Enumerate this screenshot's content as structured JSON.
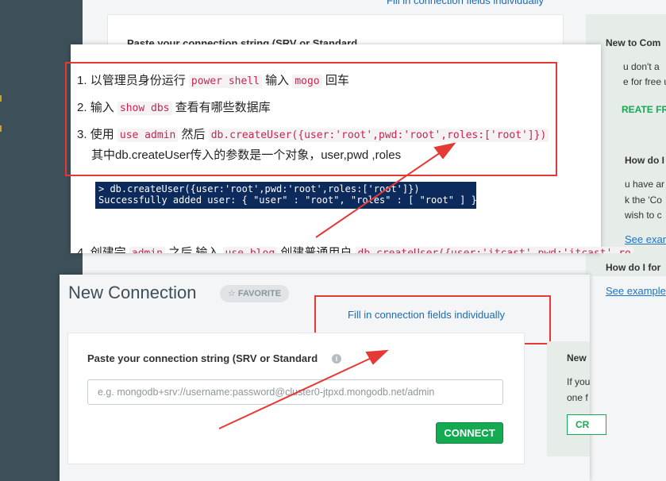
{
  "background": {
    "top_link": "Fill in connection fields individually",
    "card_label": "Paste your connection string (SRV or Standard",
    "right_panel": {
      "title": "New to Com",
      "line1": "u don't a",
      "line2": "e for free u",
      "create_button": "REATE FR",
      "q1": "How do I fin",
      "q1_line1": "u have ar",
      "q1_line2": "k the 'Co",
      "q1_line3": "wish to c",
      "see_example1": "See example",
      "q2": "How do I for",
      "see_example2": "See example"
    }
  },
  "note": {
    "steps": [
      {
        "num": "1.",
        "pre": "以管理员身份运行",
        "code1": "power shell",
        "mid": "输入",
        "code2": "mogo",
        "post": "回车"
      },
      {
        "num": "2.",
        "pre": "输入",
        "code1": "show dbs",
        "post": "查看有哪些数据库"
      },
      {
        "num": "3.",
        "pre": "使用",
        "code1": "use admin",
        "mid": "然后",
        "code2": "db.createUser({user:'root',pwd:'root',roles:['root']})",
        "line2": "其中db.createUser传入的参数是一个对象，user,pwd ,roles"
      }
    ],
    "terminal_line1": "> db.createUser({user:'root',pwd:'root',roles:['root']})",
    "terminal_line2": "Successfully added user: { \"user\" : \"root\", \"roles\" : [ \"root\" ] }",
    "step4": {
      "num": "4.",
      "pre": "创建完",
      "code1": "admin",
      "mid": "之后 输入",
      "code2": "use blog",
      "mid2": "创建普通用户",
      "code3": "db.createUser({user:'itcast',pwd:'itcast',ro"
    }
  },
  "connection": {
    "title": "New Connection",
    "favorite_label": "FAVORITE",
    "fill_link": "Fill in connection fields individually",
    "paste_label": "Paste your connection string (SRV or Standard",
    "info_glyph": "i",
    "input_placeholder": "e.g. mongodb+srv://username:password@cluster0-jtpxd.mongodb.net/admin",
    "connect_button": "CONNECT",
    "right": {
      "line0": "New",
      "line1": "If you",
      "line2": "one f",
      "button": "CR"
    }
  },
  "colors": {
    "annotation_red": "#e53935",
    "connect_green": "#13aa52",
    "link_blue": "#1a6bb5"
  }
}
